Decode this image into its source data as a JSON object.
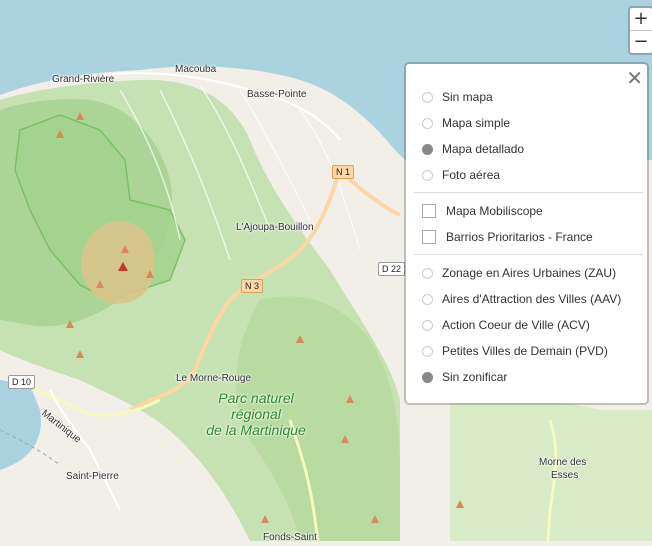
{
  "map": {
    "places": {
      "grand_riviere": "Grand-Rivière",
      "macouba": "Macouba",
      "basse_pointe": "Basse-Pointe",
      "ajoupa": "L'Ajoupa-Bouillon",
      "morne_rouge": "Le Morne-Rouge",
      "martinique": "Martinique",
      "saint_pierre": "Saint-Pierre",
      "fonds_saint": "Fonds-Saint",
      "morne_des_esses_1": "Morne des",
      "morne_des_esses_2": "Esses"
    },
    "park_lines": [
      "Parc naturel",
      "régional",
      "de la Martinique"
    ],
    "roads": {
      "n1": "N 1",
      "n3": "N 3",
      "d22": "D 22",
      "d10": "D 10"
    }
  },
  "zoom": {
    "in": "+",
    "out": "−"
  },
  "layers": {
    "close": "✕",
    "base": [
      {
        "label": "Sin mapa",
        "selected": false
      },
      {
        "label": "Mapa simple",
        "selected": false
      },
      {
        "label": "Mapa detallado",
        "selected": true
      },
      {
        "label": "Foto aérea",
        "selected": false
      }
    ],
    "overlays": [
      {
        "label": "Mapa Mobiliscope",
        "checked": false
      },
      {
        "label": "Barrios Prioritarios - France",
        "checked": false
      }
    ],
    "zoning": [
      {
        "label": "Zonage en Aires Urbaines (ZAU)",
        "selected": false
      },
      {
        "label": "Aires d'Attraction des Villes (AAV)",
        "selected": false
      },
      {
        "label": "Action Coeur de Ville (ACV)",
        "selected": false
      },
      {
        "label": "Petites Villes de Demain (PVD)",
        "selected": false
      },
      {
        "label": "Sin zonificar",
        "selected": true
      }
    ]
  }
}
